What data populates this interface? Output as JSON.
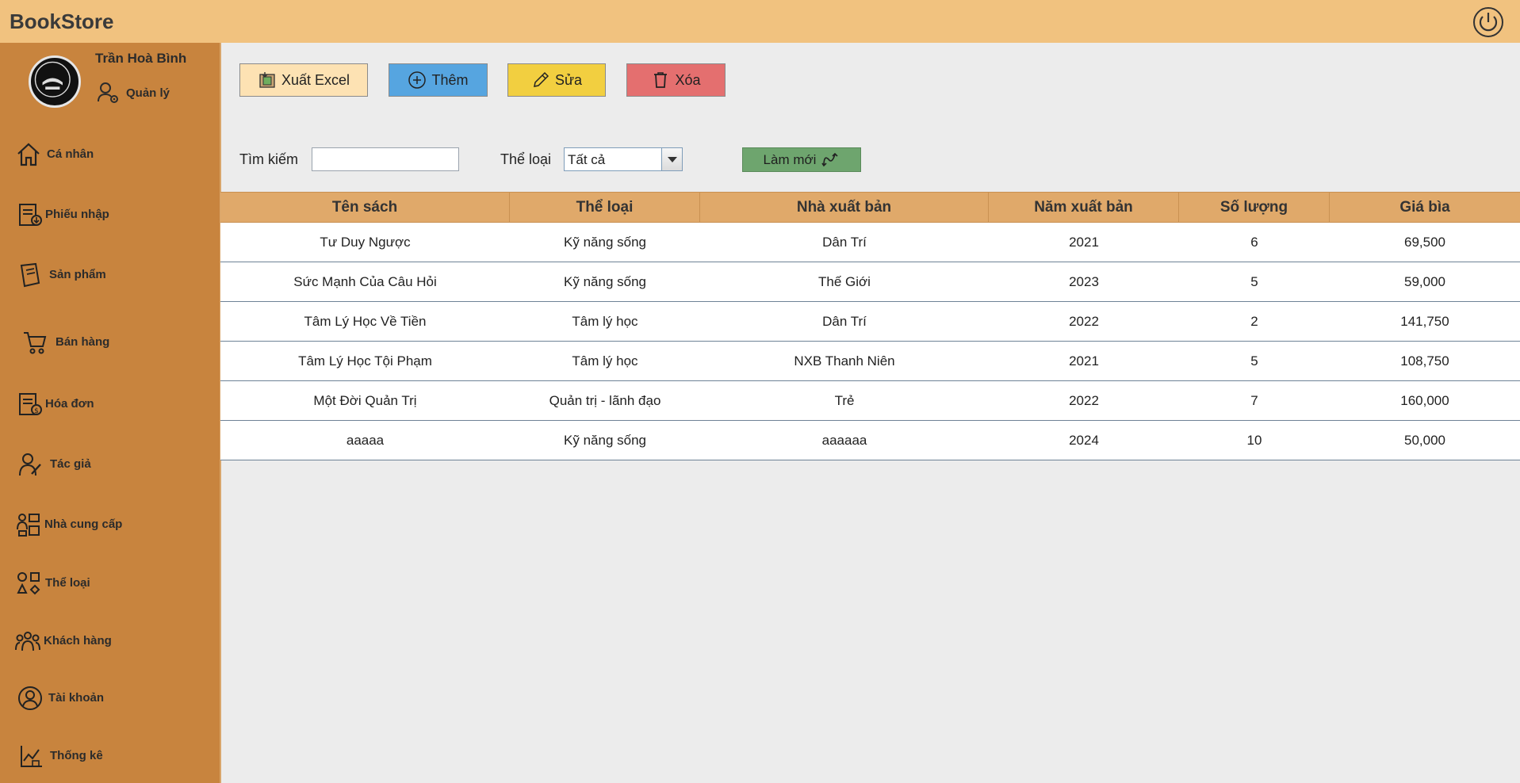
{
  "app": {
    "title": "BookStore"
  },
  "user": {
    "name": "Trần Hoà Bình",
    "role": "Quản lý"
  },
  "sidebar": {
    "items": [
      {
        "label": "Cá nhân",
        "icon": "home-icon"
      },
      {
        "label": "Phiếu nhập",
        "icon": "import-receipt-icon"
      },
      {
        "label": "Sản phẩm",
        "icon": "book-icon"
      },
      {
        "label": "Bán hàng",
        "icon": "cart-icon"
      },
      {
        "label": "Hóa đơn",
        "icon": "invoice-icon"
      },
      {
        "label": "Tác giả",
        "icon": "author-icon"
      },
      {
        "label": "Nhà cung cấp",
        "icon": "supplier-icon"
      },
      {
        "label": "Thể loại",
        "icon": "category-icon"
      },
      {
        "label": "Khách hàng",
        "icon": "customers-icon"
      },
      {
        "label": "Tài khoản",
        "icon": "account-icon"
      },
      {
        "label": "Thống kê",
        "icon": "statistics-icon"
      }
    ]
  },
  "toolbar": {
    "export_label": "Xuất Excel",
    "add_label": "Thêm",
    "edit_label": "Sửa",
    "delete_label": "Xóa",
    "colors": {
      "export": "#fde2b3",
      "add": "#56a5e0",
      "edit": "#f2cf40",
      "delete": "#e46f6f"
    }
  },
  "filters": {
    "search_label": "Tìm kiếm",
    "search_value": "",
    "category_label": "Thể loại",
    "category_selected": "Tất cả",
    "refresh_label": "Làm mới"
  },
  "table": {
    "columns": [
      "Tên sách",
      "Thể loại",
      "Nhà xuất bản",
      "Năm xuất bản",
      "Số lượng",
      "Giá bìa"
    ],
    "rows": [
      [
        "Tư Duy Ngược",
        "Kỹ năng sống",
        "Dân Trí",
        "2021",
        "6",
        "69,500"
      ],
      [
        "Sức Mạnh Của Câu Hỏi",
        "Kỹ năng sống",
        "Thế Giới",
        "2023",
        "5",
        "59,000"
      ],
      [
        "Tâm Lý Học Về Tiền",
        "Tâm lý học",
        "Dân Trí",
        "2022",
        "2",
        "141,750"
      ],
      [
        "Tâm Lý Học Tội Phạm",
        "Tâm lý học",
        "NXB Thanh Niên",
        "2021",
        "5",
        "108,750"
      ],
      [
        "Một Đời Quản Trị",
        "Quản trị - lãnh đạo",
        "Trẻ",
        "2022",
        "7",
        "160,000"
      ],
      [
        "aaaaa",
        "Kỹ năng sống",
        "aaaaaa",
        "2024",
        "10",
        "50,000"
      ]
    ]
  }
}
